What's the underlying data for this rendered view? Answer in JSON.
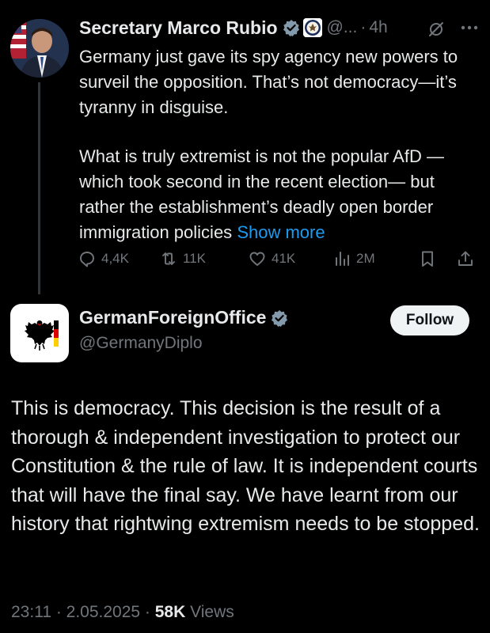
{
  "quoted_tweet": {
    "author_name": "Secretary Marco Rubio",
    "handle": "@...",
    "time": "4h",
    "separator": "·",
    "text_para1": "Germany just gave its spy agency new powers to surveil the opposition.  That’s not democracy—it’s tyranny in disguise.",
    "text_para2": "What is truly extremist is not the popular AfD —which took second in the recent election— but rather the establishment’s deadly open border immigration policies",
    "show_more": "Show more",
    "stats": {
      "replies": "4,4K",
      "reposts": "11K",
      "likes": "41K",
      "views": "2M"
    },
    "icons": [
      "verified-badge-icon",
      "state-department-seal-icon",
      "grok-icon",
      "more-icon",
      "reply-icon",
      "repost-icon",
      "like-icon",
      "views-icon",
      "bookmark-icon",
      "share-icon"
    ]
  },
  "main_tweet": {
    "author_name": "GermanForeignOffice",
    "handle": "@GermanyDiplo",
    "follow_label": "Follow",
    "text": "This is democracy. This decision is the result of a thorough & independent investigation to protect our Constitution & the rule of law. It is independent courts that will have the final say. We have learnt from our history that rightwing extremism needs to be stopped.",
    "timestamp": "23:11 · 2.05.2025 · ",
    "views_count": "58K",
    "views_label": " Views"
  },
  "colors": {
    "background": "#000000",
    "text_primary": "#e7e9ea",
    "text_secondary": "#71767b",
    "link": "#1d9bf0",
    "verified": "#829aab",
    "follow_bg": "#eff3f4"
  }
}
